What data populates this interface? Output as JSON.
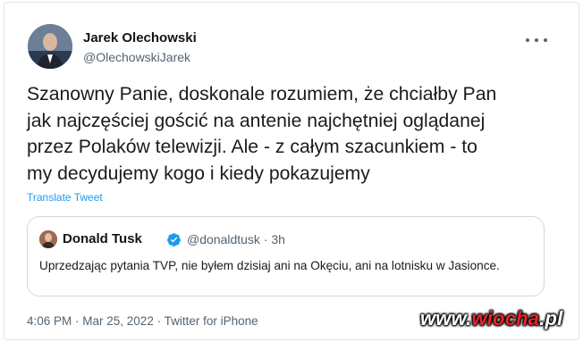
{
  "author": {
    "name": "Jarek Olechowski",
    "handle": "@OlechowskiJarek"
  },
  "tweet": {
    "text": "Szanowny Panie, doskonale rozumiem, że chciałby Pan\njak najczęściej gościć na antenie najchętniej oglądanej\nprzez Polaków telewizji. Ale - z całym szacunkiem - to\nmy decydujemy kogo i kiedy pokazujemy",
    "translate_label": "Translate Tweet",
    "footer": "4:06 PM · Mar 25, 2022 · Twitter for iPhone"
  },
  "quote": {
    "name": "Donald Tusk",
    "meta": "@donaldtusk · 3h",
    "text": "Uprzedzając pytania TVP, nie byłem dzisiaj ani na Okęciu, ani na lotnisku w Jasionce."
  },
  "watermark": {
    "prefix": "www.",
    "brand": "wiocha",
    "suffix": ".pl"
  },
  "icons": {
    "more": "more-horizontal-icon",
    "verified": "verified-badge-icon"
  },
  "colors": {
    "link": "#1d9bf0",
    "secondary_text": "#536471",
    "watermark_accent": "#e8242b"
  }
}
